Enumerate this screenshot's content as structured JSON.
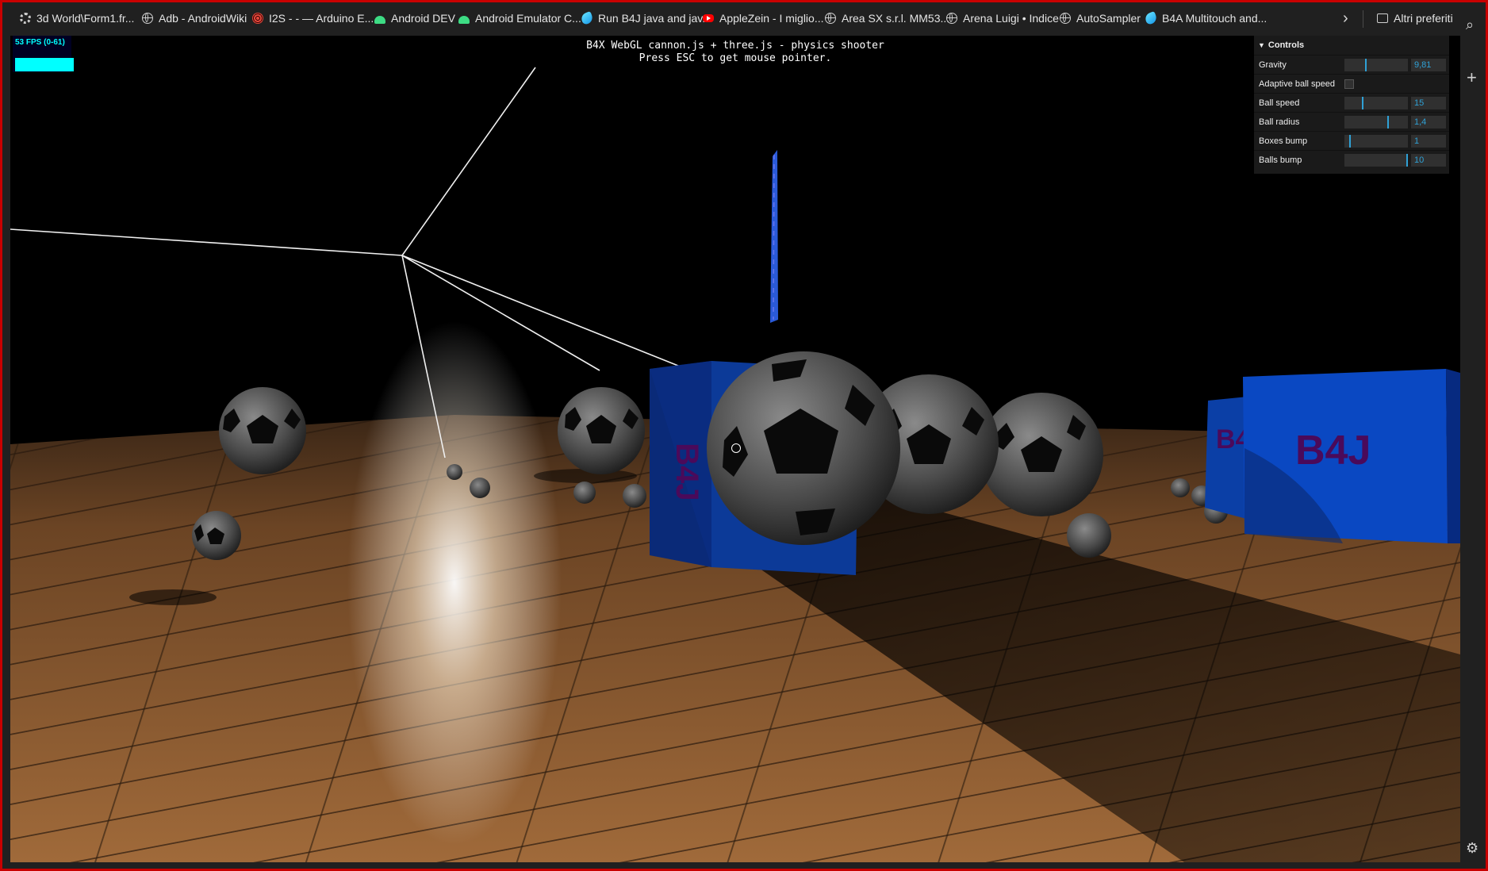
{
  "bookmarks": [
    {
      "label": "3d World\\Form1.fr...",
      "icon": "gear-icon"
    },
    {
      "label": "Adb - AndroidWiki",
      "icon": "globe-icon"
    },
    {
      "label": "I2S - - — Arduino E...",
      "icon": "arduino-icon"
    },
    {
      "label": "Android DEV",
      "icon": "android-icon"
    },
    {
      "label": "Android Emulator C...",
      "icon": "android-icon"
    },
    {
      "label": "Run B4J java and jav...",
      "icon": "b4x-flame-icon"
    },
    {
      "label": "AppleZein - I miglio...",
      "icon": "youtube-icon"
    },
    {
      "label": "Area SX s.r.l. MM53...",
      "icon": "globe-icon"
    },
    {
      "label": "Arena Luigi • Indice",
      "icon": "globe-icon"
    },
    {
      "label": "AutoSampler",
      "icon": "globe-icon"
    },
    {
      "label": "B4A Multitouch and...",
      "icon": "b4x-flame-icon"
    }
  ],
  "other_bookmarks": "Altri preferiti",
  "fps": "53 FPS (0-61)",
  "info": {
    "line1": "B4X WebGL cannon.js + three.js - physics shooter",
    "line2": "Press ESC to get mouse pointer."
  },
  "controls": {
    "title": "Controls",
    "rows": [
      {
        "label": "Gravity",
        "value": "9,81",
        "fraction": 0.33
      },
      {
        "label": "Adaptive ball speed",
        "checked": false
      },
      {
        "label": "Ball speed",
        "value": "15",
        "fraction": 0.28
      },
      {
        "label": "Ball radius",
        "value": "1,4",
        "fraction": 0.67
      },
      {
        "label": "Boxes bump",
        "value": "1",
        "fraction": 0.08
      },
      {
        "label": "Balls bump",
        "value": "10",
        "fraction": 0.98
      }
    ]
  },
  "box_text": "B4J",
  "colors": {
    "slider_accent": "#2fa1d6",
    "box_blue": "#0a3a9a",
    "box_text": "#4a0a5a",
    "fps_cyan": "#00ffff",
    "window_border": "#c80000"
  }
}
